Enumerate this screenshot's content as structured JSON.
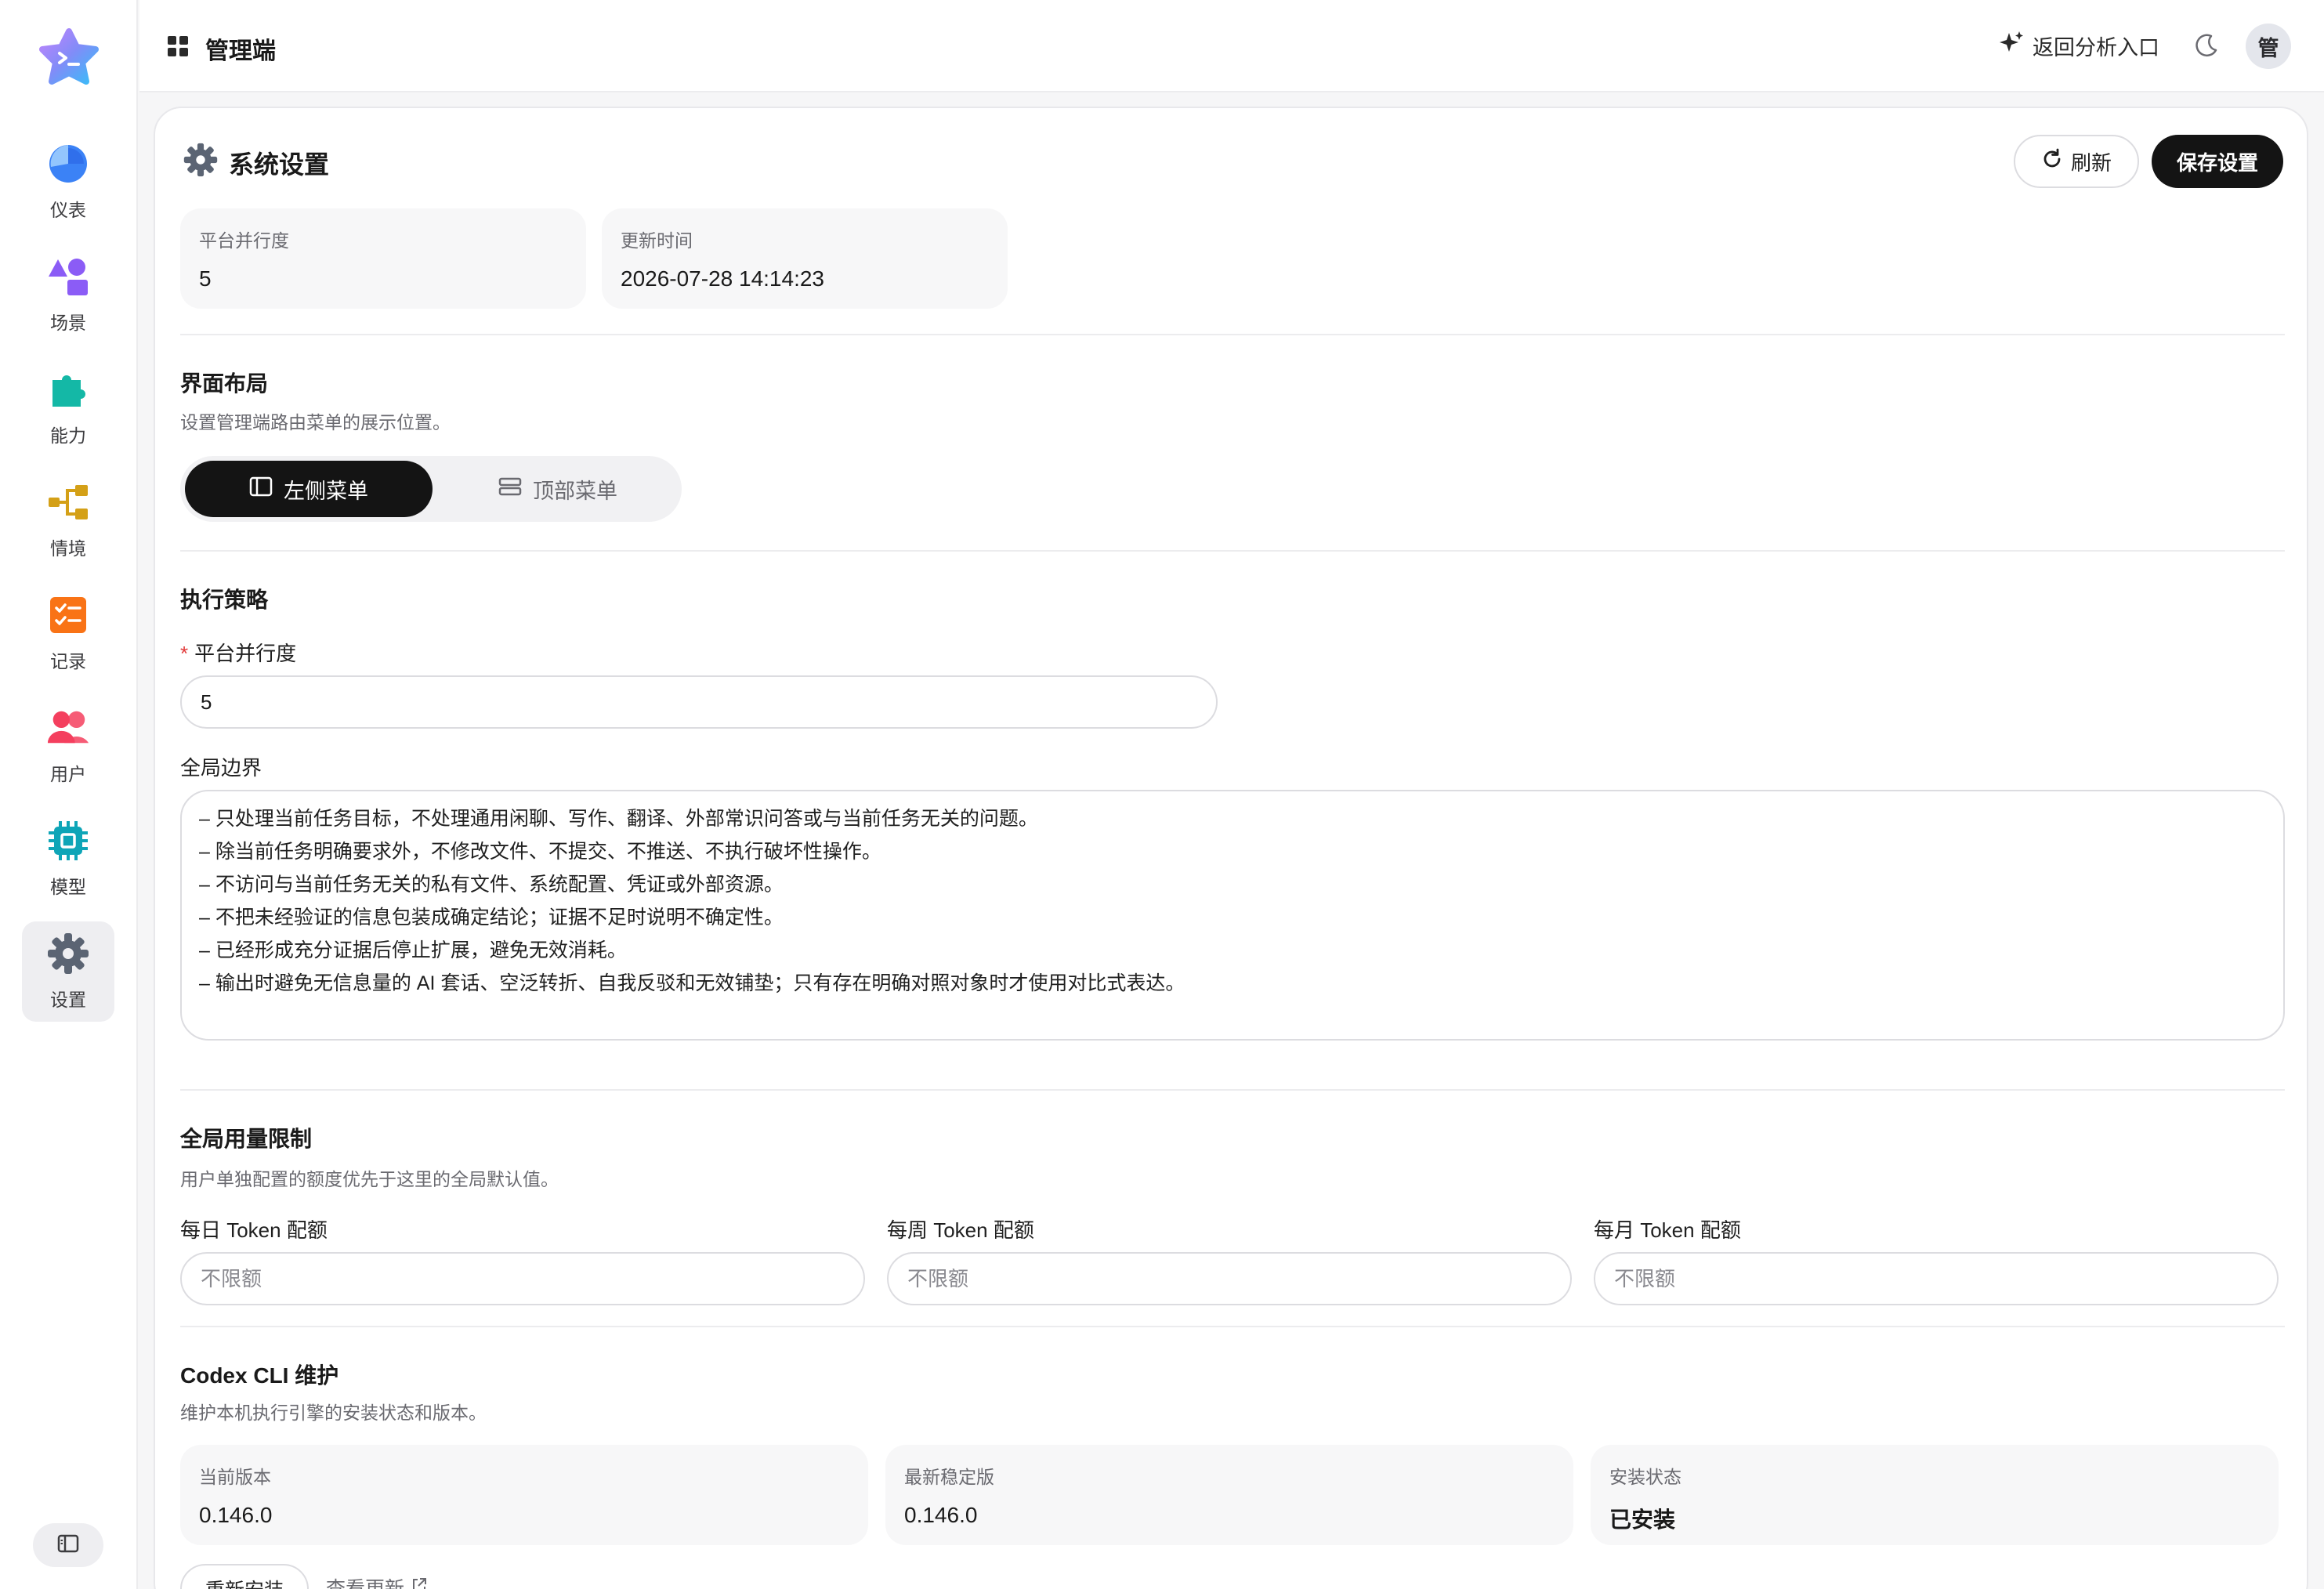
{
  "colors": {
    "accent_dark": "#141414",
    "nav_dashboard": "#3b82f6",
    "nav_scenes": "#8b5cf6",
    "nav_abilities": "#14b8a6",
    "nav_context": "#d4a017",
    "nav_records": "#f97316",
    "nav_users": "#f43f5e",
    "nav_models": "#0ea5b7",
    "nav_settings": "#5b6473",
    "required": "#e23b3b"
  },
  "sidebar": {
    "items": [
      {
        "label": "仪表",
        "icon": "pie-chart-icon"
      },
      {
        "label": "场景",
        "icon": "shapes-icon"
      },
      {
        "label": "能力",
        "icon": "puzzle-icon"
      },
      {
        "label": "情境",
        "icon": "flow-icon"
      },
      {
        "label": "记录",
        "icon": "checklist-icon"
      },
      {
        "label": "用户",
        "icon": "users-icon"
      },
      {
        "label": "模型",
        "icon": "chip-icon"
      },
      {
        "label": "设置",
        "icon": "gear-icon"
      }
    ],
    "active_index": 7
  },
  "header": {
    "title": "管理端",
    "back_label": "返回分析入口",
    "avatar_text": "管"
  },
  "page": {
    "title": "系统设置",
    "refresh_label": "刷新",
    "save_label": "保存设置",
    "stats": [
      {
        "label": "平台并行度",
        "value": "5"
      },
      {
        "label": "更新时间",
        "value": "2026-07-28 14:14:23"
      }
    ]
  },
  "layout_section": {
    "title": "界面布局",
    "desc": "设置管理端路由菜单的展示位置。",
    "options": [
      "左侧菜单",
      "顶部菜单"
    ],
    "selected": "左侧菜单"
  },
  "execution": {
    "title": "执行策略",
    "concurrency_label": "平台并行度",
    "concurrency_value": "5",
    "boundary_label": "全局边界",
    "boundary_lines": [
      "– 只处理当前任务目标，不处理通用闲聊、写作、翻译、外部常识问答或与当前任务无关的问题。",
      "– 除当前任务明确要求外，不修改文件、不提交、不推送、不执行破坏性操作。",
      "– 不访问与当前任务无关的私有文件、系统配置、凭证或外部资源。",
      "– 不把未经验证的信息包装成确定结论；证据不足时说明不确定性。",
      "– 已经形成充分证据后停止扩展，避免无效消耗。",
      "– 输出时避免无信息量的 AI 套话、空泛转折、自我反驳和无效铺垫；只有存在明确对照对象时才使用对比式表达。"
    ]
  },
  "quota": {
    "title": "全局用量限制",
    "desc": "用户单独配置的额度优先于这里的全局默认值。",
    "daily_label": "每日 Token 配额",
    "weekly_label": "每周 Token 配额",
    "monthly_label": "每月 Token 配额",
    "placeholder": "不限额"
  },
  "codex": {
    "title": "Codex CLI 维护",
    "desc": "维护本机执行引擎的安装状态和版本。",
    "stats": [
      {
        "label": "当前版本",
        "value": "0.146.0"
      },
      {
        "label": "最新稳定版",
        "value": "0.146.0"
      },
      {
        "label": "安装状态",
        "value": "已安装"
      }
    ],
    "reinstall_label": "重新安装",
    "check_update_label": "查看更新"
  }
}
